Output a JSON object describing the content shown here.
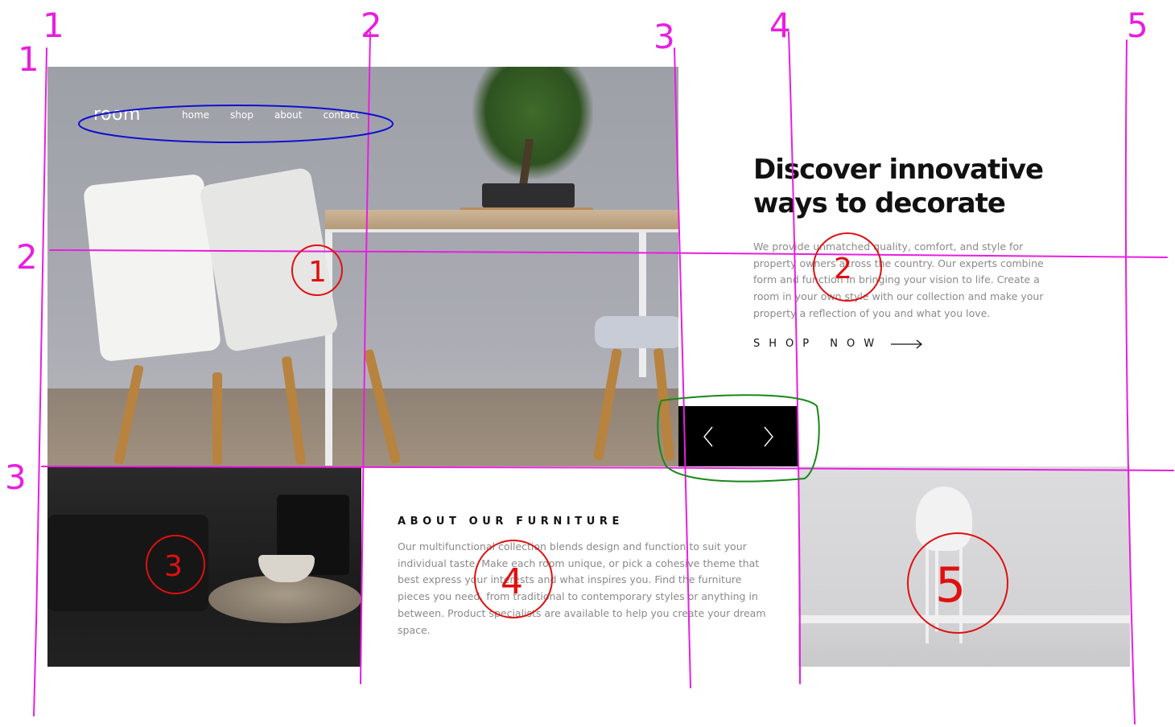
{
  "nav": {
    "logo": "room",
    "links": [
      "home",
      "shop",
      "about",
      "contact"
    ]
  },
  "hero": {
    "headline_line1": "Discover innovative",
    "headline_line2": "ways to decorate",
    "description": "We provide unmatched quality, comfort, and style for property owners across the country. Our experts combine form and function in bringing your vision to life. Create a room in your own style with our collection and make your property a reflection of you and what you love.",
    "cta_label": "SHOP NOW"
  },
  "about": {
    "title": "ABOUT OUR FURNITURE",
    "body": "Our multifunctional collection blends design and function to suit your individual taste. Make each room unique, or pick a cohesive theme that best express your interests and what inspires you. Find the furniture pieces you need, from traditional to contemporary styles or anything in between. Product specialists are available to help you create your dream space."
  },
  "annotations": {
    "column_numbers": [
      "1",
      "2",
      "3",
      "4",
      "5"
    ],
    "row_numbers": [
      "1",
      "2",
      "3"
    ],
    "region_numbers": [
      "1",
      "2",
      "3",
      "4",
      "5"
    ],
    "colors": {
      "grid": "#e81ee0",
      "region": "#e01010",
      "nav_box": "#1010d0",
      "slider_box": "#188818"
    }
  },
  "icons": [
    "chevron-left-icon",
    "chevron-right-icon",
    "arrow-right-icon"
  ]
}
